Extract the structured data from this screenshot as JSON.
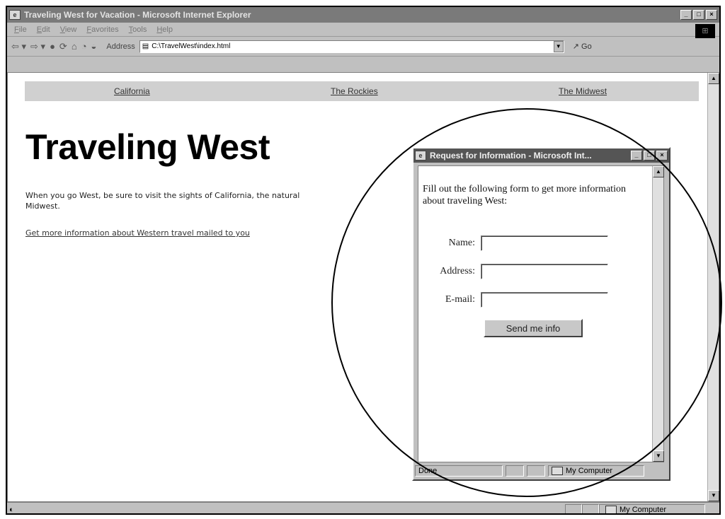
{
  "window": {
    "title": "Traveling West for Vacation - Microsoft Internet Explorer",
    "controls": {
      "minimize": "_",
      "maximize": "□",
      "close": "×"
    }
  },
  "menu": [
    "File",
    "Edit",
    "View",
    "Favorites",
    "Tools",
    "Help"
  ],
  "toolbar": {
    "address_label": "Address",
    "address_value": "C:\\TravelWest\\index.html",
    "go_label": "Go"
  },
  "page": {
    "nav": [
      "California",
      "The Rockies",
      "The Midwest"
    ],
    "heading": "Traveling West",
    "intro": "When you go West, be sure to visit the sights of California, the natural",
    "intro_line2": "Midwest.",
    "info_link": "Get more information about Western travel mailed to you"
  },
  "statusbar": {
    "zone": "My Computer"
  },
  "popup": {
    "title": "Request for Information - Microsoft Int...",
    "intro": "Fill out the following form to get more information about traveling West:",
    "fields": [
      {
        "label": "Name:",
        "value": ""
      },
      {
        "label": "Address:",
        "value": ""
      },
      {
        "label": "E-mail:",
        "value": ""
      }
    ],
    "submit_label": "Send me info",
    "status_text": "Done",
    "status_zone": "My Computer"
  }
}
